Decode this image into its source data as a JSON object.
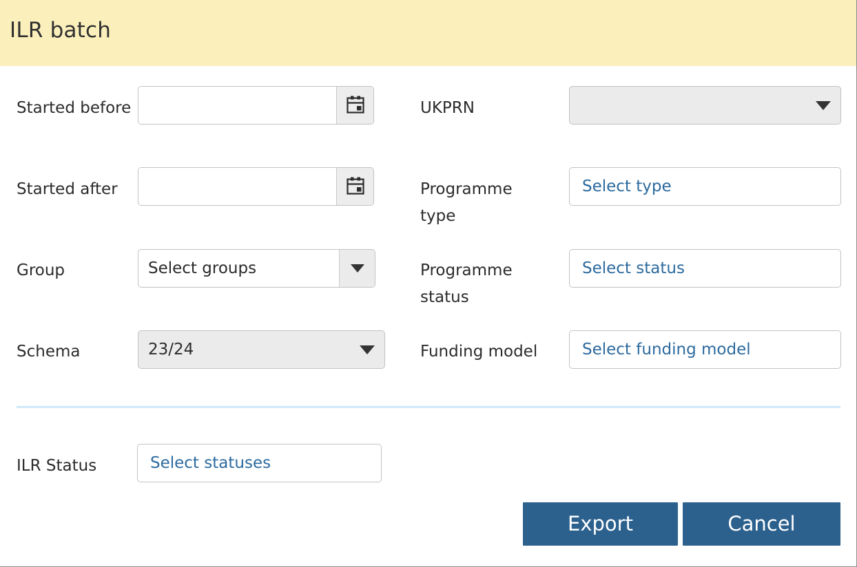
{
  "dialog": {
    "title": "ILR batch",
    "header_color": "#fbf0bc",
    "accent_blue": "#2c618e",
    "link_blue": "#2c6a9e",
    "divider_color": "#cfe9fb"
  },
  "fields": {
    "started_before": {
      "label": "Started before",
      "value": "",
      "placeholder": "",
      "icon": "calendar-icon"
    },
    "started_after": {
      "label": "Started after",
      "value": "",
      "placeholder": "",
      "icon": "calendar-icon"
    },
    "group": {
      "label": "Group",
      "value": "Select groups",
      "icon": "chevron-down-icon"
    },
    "schema": {
      "label": "Schema",
      "value": "23/24",
      "icon": "chevron-down-icon"
    },
    "ukprn": {
      "label": "UKPRN",
      "value": "",
      "icon": "chevron-down-icon"
    },
    "programme_type": {
      "label": "Programme type",
      "placeholder": "Select type"
    },
    "programme_status": {
      "label": "Programme status",
      "placeholder": "Select status"
    },
    "funding_model": {
      "label": "Funding model",
      "placeholder": "Select funding model"
    },
    "ilr_status": {
      "label": "ILR Status",
      "placeholder": "Select statuses"
    }
  },
  "footer": {
    "export_label": "Export",
    "cancel_label": "Cancel"
  }
}
